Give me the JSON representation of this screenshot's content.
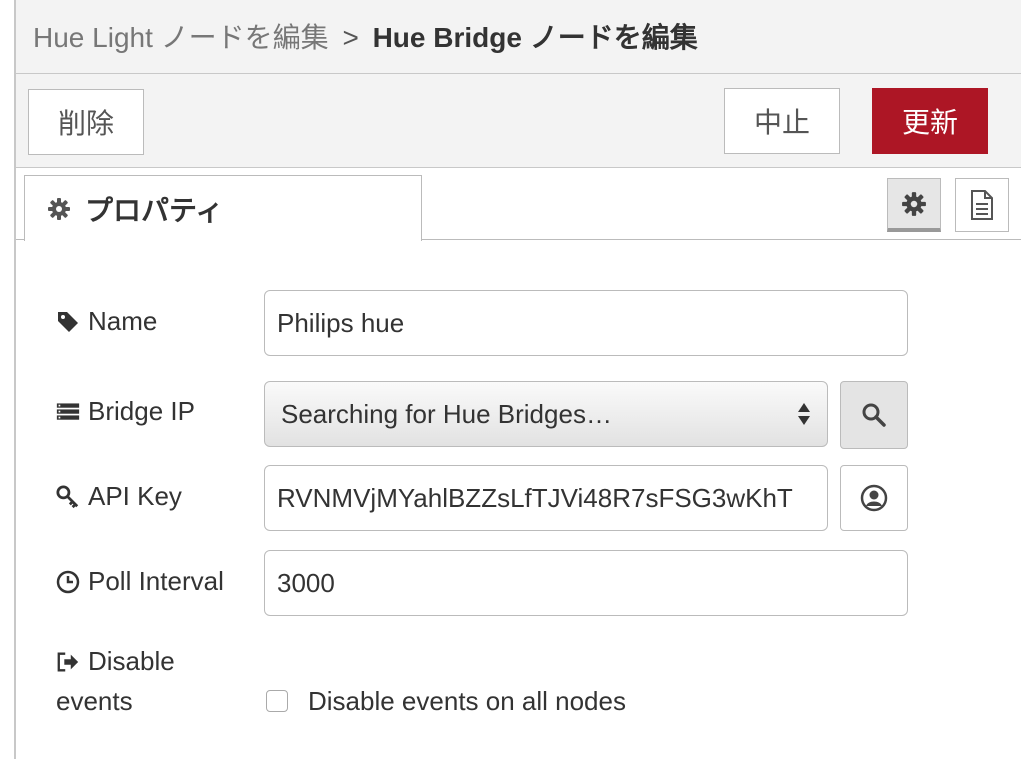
{
  "header": {
    "parent": "Hue Light ノードを編集",
    "separator": ">",
    "current": "Hue Bridge ノードを編集"
  },
  "toolbar": {
    "delete_label": "削除",
    "cancel_label": "中止",
    "update_label": "更新"
  },
  "tabs": {
    "properties_label": "プロパティ"
  },
  "colors": {
    "primary": "#ad1625",
    "panel_bg": "#f3f3f3",
    "border": "#bbbbbb"
  },
  "form": {
    "name": {
      "label": "Name",
      "value": "Philips hue",
      "icon": "tag-icon"
    },
    "bridge_ip": {
      "label": "Bridge IP",
      "value": "Searching for Hue Bridges…",
      "icon": "server-icon",
      "button_icon": "search-icon"
    },
    "api_key": {
      "label": "API Key",
      "value": "RVNMVjMYahlBZZsLfTJVi48R7sFSG3wKhT",
      "icon": "key-icon",
      "button_icon": "user-circle-icon"
    },
    "poll_interval": {
      "label": "Poll Interval",
      "value": "3000",
      "icon": "clock-icon"
    },
    "disable_events": {
      "label_line1": "Disable",
      "label_line2": "events",
      "checkbox_label": "Disable events on all nodes",
      "checked": false,
      "icon": "sign-out-icon"
    }
  }
}
